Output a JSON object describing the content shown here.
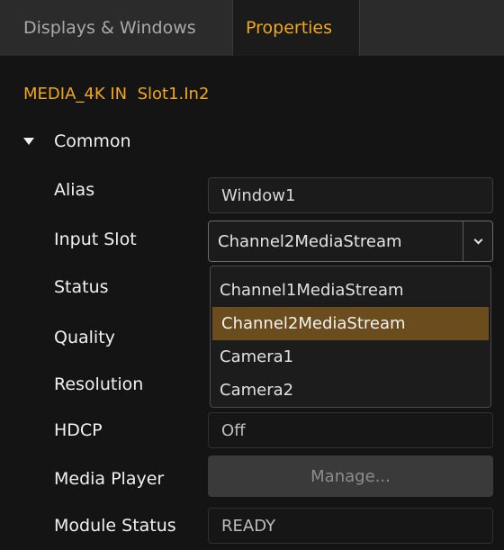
{
  "tabs": {
    "inactive": "Displays & Windows",
    "active": "Properties"
  },
  "header": {
    "title": "MEDIA_4K IN  Slot1.In2"
  },
  "section": {
    "label": "Common"
  },
  "labels": {
    "alias": "Alias",
    "input_slot": "Input Slot",
    "status": "Status",
    "quality": "Quality",
    "resolution": "Resolution",
    "hdcp": "HDCP",
    "media_player": "Media Player",
    "module_status": "Module Status"
  },
  "fields": {
    "alias": "Window1",
    "input_slot": "Channel2MediaStream",
    "hdcp": "Off",
    "module_status": "READY"
  },
  "dropdown": {
    "options": [
      "Channel1MediaStream",
      "Channel2MediaStream",
      "Camera1",
      "Camera2"
    ]
  },
  "buttons": {
    "manage": "Manage..."
  },
  "colors": {
    "accent": "#f0a81a",
    "selected_option": "#6b4c1d"
  }
}
